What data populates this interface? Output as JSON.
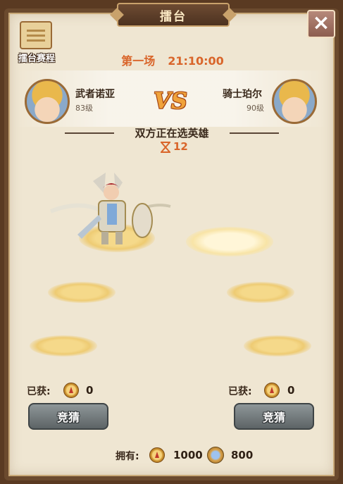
{
  "header": {
    "title": "擂台",
    "close_icon": "close-icon"
  },
  "schedule": {
    "label": "擂台赛程",
    "icon": "scroll-icon"
  },
  "round": {
    "name": "第一场",
    "time": "21:10:00"
  },
  "players": {
    "left": {
      "name": "武者诺亚",
      "level": "83级"
    },
    "right": {
      "name": "骑士珀尔",
      "level": "90级"
    }
  },
  "vs_text": "VS",
  "status": {
    "text": "双方正在选英雄",
    "countdown": "12",
    "icon": "hourglass-icon"
  },
  "bets": {
    "left": {
      "label": "已获:",
      "value": "0",
      "button": "竞猜"
    },
    "right": {
      "label": "已获:",
      "value": "0",
      "button": "竞猜"
    }
  },
  "owned": {
    "label": "拥有:",
    "coin_value": "1000",
    "medal_value": "800"
  },
  "colors": {
    "accent": "#d9652a",
    "frame": "#6b4a2e",
    "panel": "#efe6d2"
  }
}
